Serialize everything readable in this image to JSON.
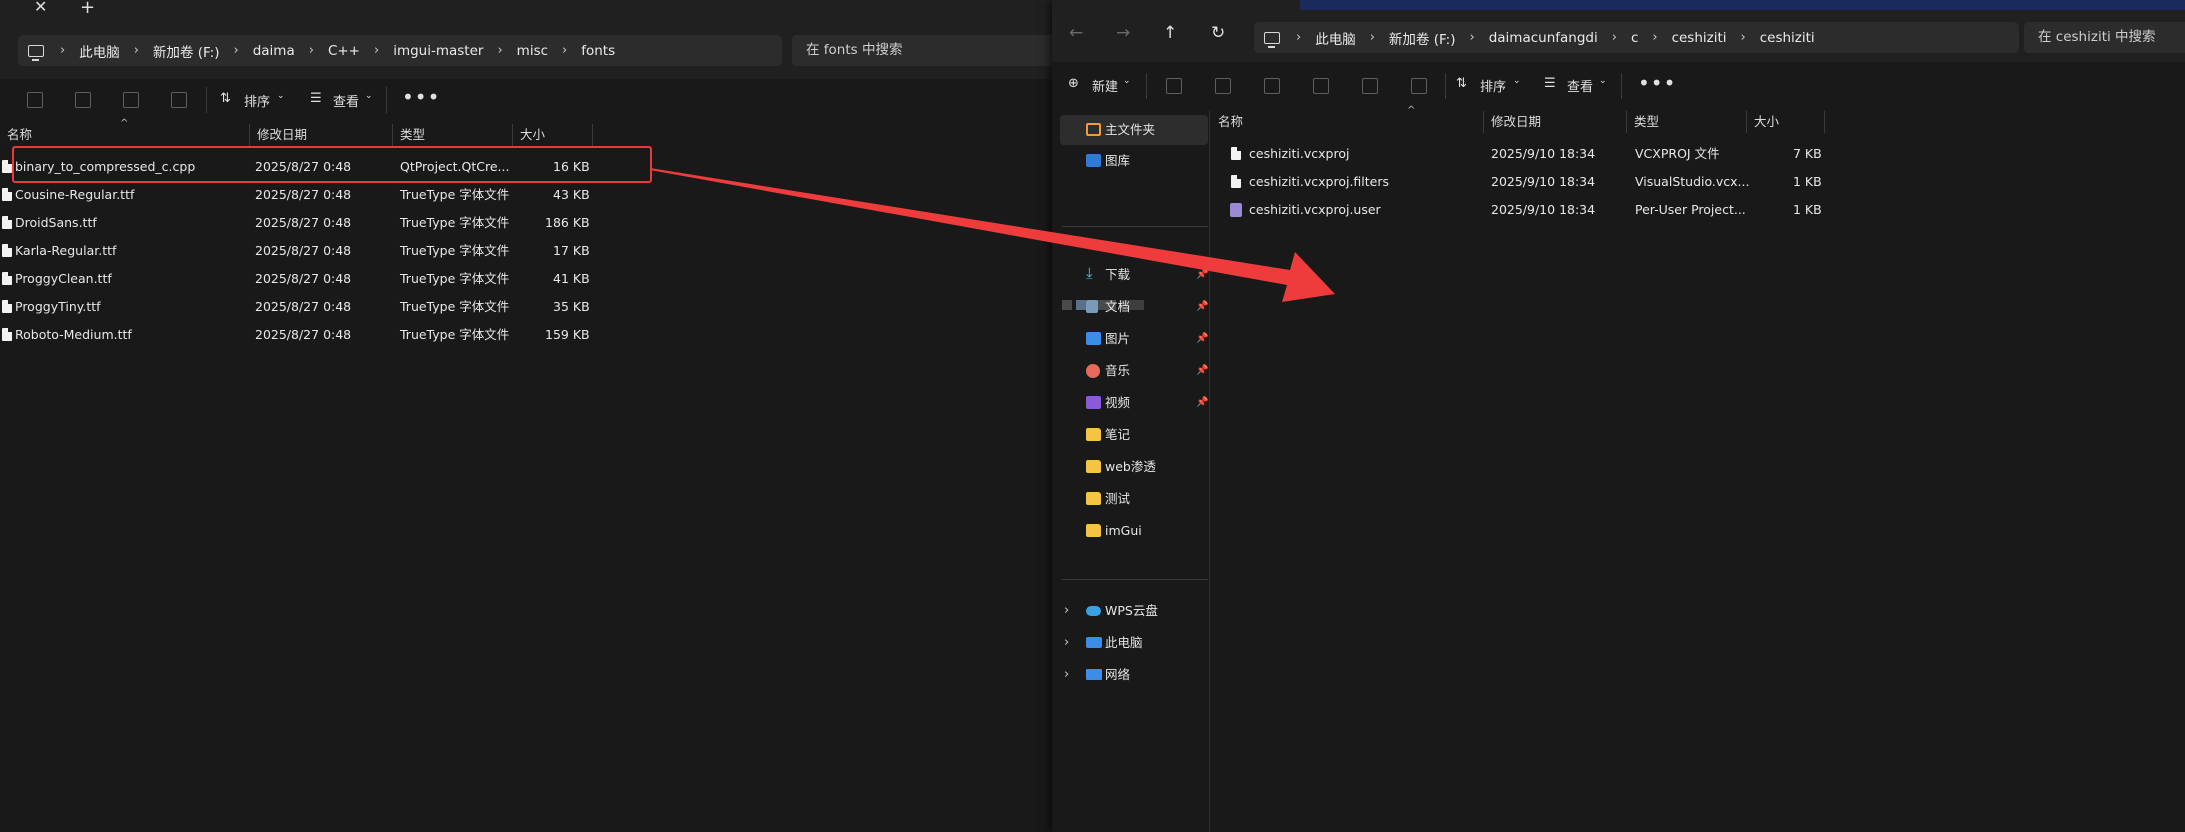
{
  "left": {
    "tab_close": "✕",
    "tab_new": "+",
    "breadcrumbs": [
      "此电脑",
      "新加卷 (F:)",
      "daima",
      "C++",
      "imgui-master",
      "misc",
      "fonts"
    ],
    "search_placeholder": "在 fonts 中搜索",
    "toolbar": {
      "sort": "排序",
      "view": "查看",
      "more": "•••"
    },
    "columns": {
      "name": "名称",
      "date": "修改日期",
      "type": "类型",
      "size": "大小"
    },
    "files": [
      {
        "name": "binary_to_compressed_c.cpp",
        "date": "2025/8/27 0:48",
        "type": "QtProject.QtCre...",
        "size": "16 KB"
      },
      {
        "name": "Cousine-Regular.ttf",
        "date": "2025/8/27 0:48",
        "type": "TrueType 字体文件",
        "size": "43 KB"
      },
      {
        "name": "DroidSans.ttf",
        "date": "2025/8/27 0:48",
        "type": "TrueType 字体文件",
        "size": "186 KB"
      },
      {
        "name": "Karla-Regular.ttf",
        "date": "2025/8/27 0:48",
        "type": "TrueType 字体文件",
        "size": "17 KB"
      },
      {
        "name": "ProggyClean.ttf",
        "date": "2025/8/27 0:48",
        "type": "TrueType 字体文件",
        "size": "41 KB"
      },
      {
        "name": "ProggyTiny.ttf",
        "date": "2025/8/27 0:48",
        "type": "TrueType 字体文件",
        "size": "35 KB"
      },
      {
        "name": "Roboto-Medium.ttf",
        "date": "2025/8/27 0:48",
        "type": "TrueType 字体文件",
        "size": "159 KB"
      }
    ]
  },
  "right": {
    "nav": {
      "back": "←",
      "forward": "→",
      "up": "↑",
      "refresh": "↻"
    },
    "breadcrumbs": [
      "此电脑",
      "新加卷 (F:)",
      "daimacunfangdi",
      "c",
      "ceshiziti",
      "ceshiziti"
    ],
    "search_placeholder": "在 ceshiziti 中搜索",
    "toolbar": {
      "new": "新建",
      "sort": "排序",
      "view": "查看",
      "more": "•••"
    },
    "sidebar": {
      "home": "主文件夹",
      "gallery": "图库",
      "quick": [
        {
          "label": "下载",
          "icon": "download-icon"
        },
        {
          "label": "文档",
          "icon": "document-icon"
        },
        {
          "label": "图片",
          "icon": "pictures-icon"
        },
        {
          "label": "音乐",
          "icon": "music-icon"
        },
        {
          "label": "视频",
          "icon": "video-icon"
        }
      ],
      "folders": [
        "笔记",
        "web渗透",
        "测试",
        "imGui"
      ],
      "locations": [
        "WPS云盘",
        "此电脑",
        "网络"
      ]
    },
    "columns": {
      "name": "名称",
      "date": "修改日期",
      "type": "类型",
      "size": "大小"
    },
    "files": [
      {
        "name": "ceshiziti.vcxproj",
        "date": "2025/9/10 18:34",
        "type": "VCXPROJ 文件",
        "size": "7 KB"
      },
      {
        "name": "ceshiziti.vcxproj.filters",
        "date": "2025/9/10 18:34",
        "type": "VisualStudio.vcx...",
        "size": "1 KB"
      },
      {
        "name": "ceshiziti.vcxproj.user",
        "date": "2025/9/10 18:34",
        "type": "Per-User Project...",
        "size": "1 KB"
      }
    ]
  },
  "colors": {
    "highlight": "#e8393b",
    "arrow": "#ee3b3b",
    "folder": "#f5c443"
  }
}
